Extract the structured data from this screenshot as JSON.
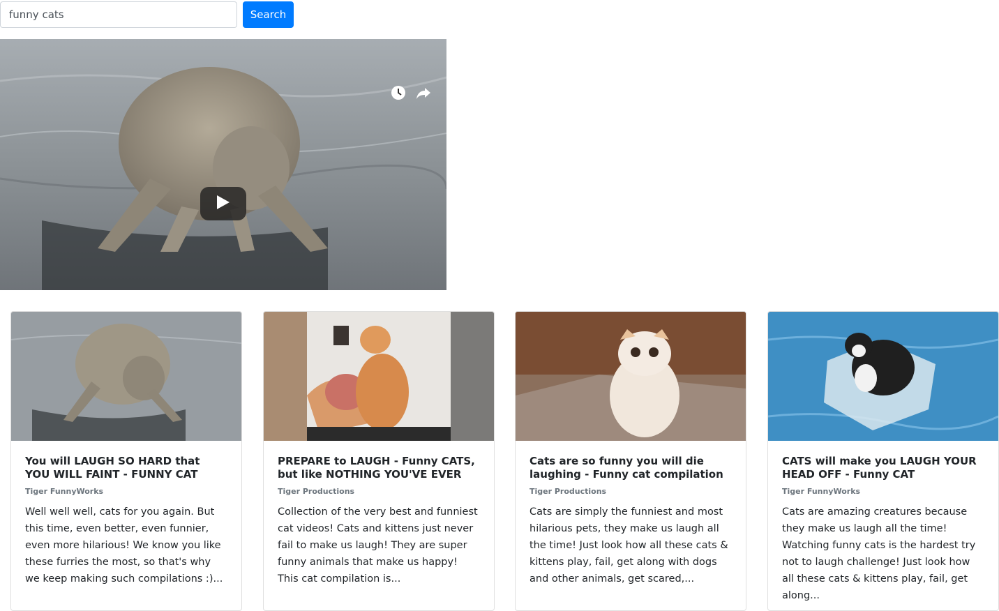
{
  "search": {
    "value": "funny cats",
    "button_label": "Search"
  },
  "player": {
    "icons": [
      "clock-icon",
      "share-icon",
      "play-icon"
    ]
  },
  "videos": [
    {
      "title": "You will LAUGH SO HARD that YOU WILL FAINT - FUNNY CAT compilation",
      "channel": "Tiger FunnyWorks",
      "description": "Well well well, cats for you again. But this time, even better, even funnier, even more hilarious! We know you like these furries the most, so that's why we keep making such compilations :)..."
    },
    {
      "title": "PREPARE to LAUGH - Funny CATS, but like NOTHING YOU'VE EVER SEEN...",
      "channel": "Tiger Productions",
      "description": "Collection of the very best and funniest cat videos! Cats and kittens just never fail to make us laugh! They are super funny animals that make us happy! This cat compilation is..."
    },
    {
      "title": "Cats are so funny you will die laughing - Funny cat compilation",
      "channel": "Tiger Productions",
      "description": "Cats are simply the funniest and most hilarious pets, they make us laugh all the time! Just look how all these cats & kittens play, fail, get along with dogs and other animals, get scared,..."
    },
    {
      "title": "CATS will make you LAUGH YOUR HEAD OFF - Funny CAT compilation",
      "channel": "Tiger FunnyWorks",
      "description": "Cats are amazing creatures because they make us laugh all the time! Watching funny cats is the hardest try not to laugh challenge! Just look how all these cats & kittens play, fail, get along..."
    }
  ]
}
